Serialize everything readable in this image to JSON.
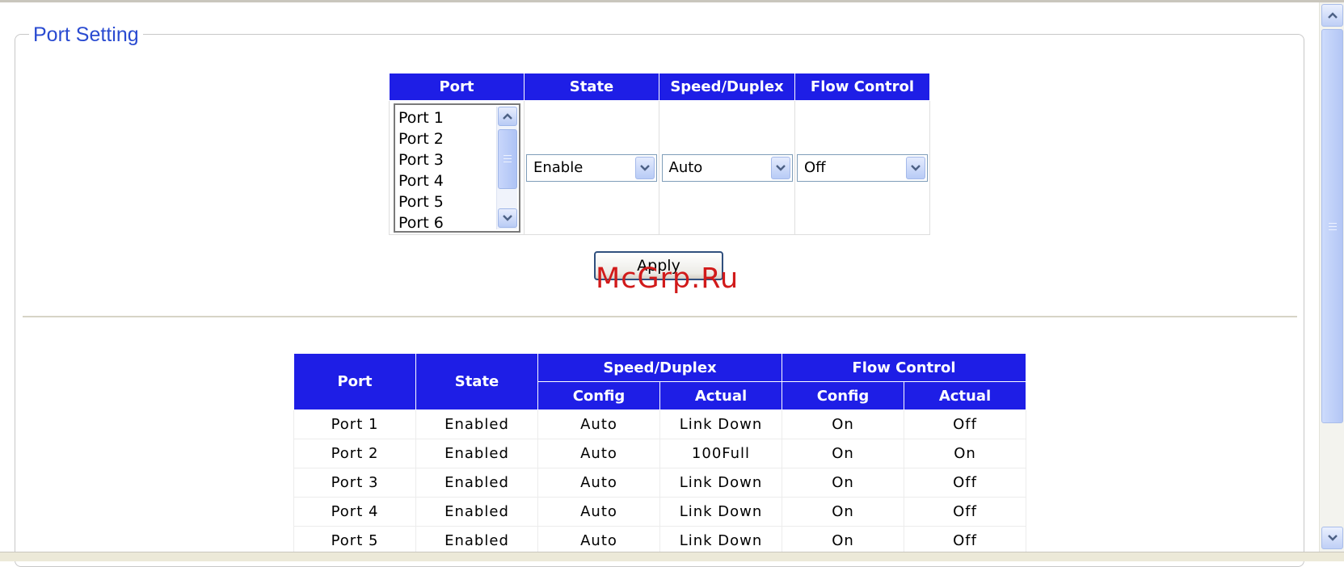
{
  "page": {
    "legend": "Port Setting",
    "watermark": "McGrp.Ru"
  },
  "config": {
    "headers": {
      "port": "Port",
      "state": "State",
      "speed": "Speed/Duplex",
      "flow": "Flow Control"
    },
    "port_list": [
      "Port 1",
      "Port 2",
      "Port 3",
      "Port 4",
      "Port 5",
      "Port 6"
    ],
    "state_value": "Enable",
    "speed_value": "Auto",
    "flow_value": "Off",
    "apply_label": "Apply"
  },
  "status": {
    "headers": {
      "port": "Port",
      "state": "State",
      "speed_group": "Speed/Duplex",
      "flow_group": "Flow Control",
      "config": "Config",
      "actual": "Actual"
    },
    "rows": [
      [
        "Port 1",
        "Enabled",
        "Auto",
        "Link Down",
        "On",
        "Off"
      ],
      [
        "Port 2",
        "Enabled",
        "Auto",
        "100Full",
        "On",
        "On"
      ],
      [
        "Port 3",
        "Enabled",
        "Auto",
        "Link Down",
        "On",
        "Off"
      ],
      [
        "Port 4",
        "Enabled",
        "Auto",
        "Link Down",
        "On",
        "Off"
      ],
      [
        "Port 5",
        "Enabled",
        "Auto",
        "Link Down",
        "On",
        "Off"
      ]
    ]
  },
  "icons": {
    "scroll_up": "chevron-up-icon",
    "scroll_down": "chevron-down-icon",
    "dropdown": "chevron-down-icon"
  },
  "colors": {
    "header_bg": "#1e1ee6",
    "legend_text": "#2a4bd1",
    "watermark": "#d11a1a"
  }
}
